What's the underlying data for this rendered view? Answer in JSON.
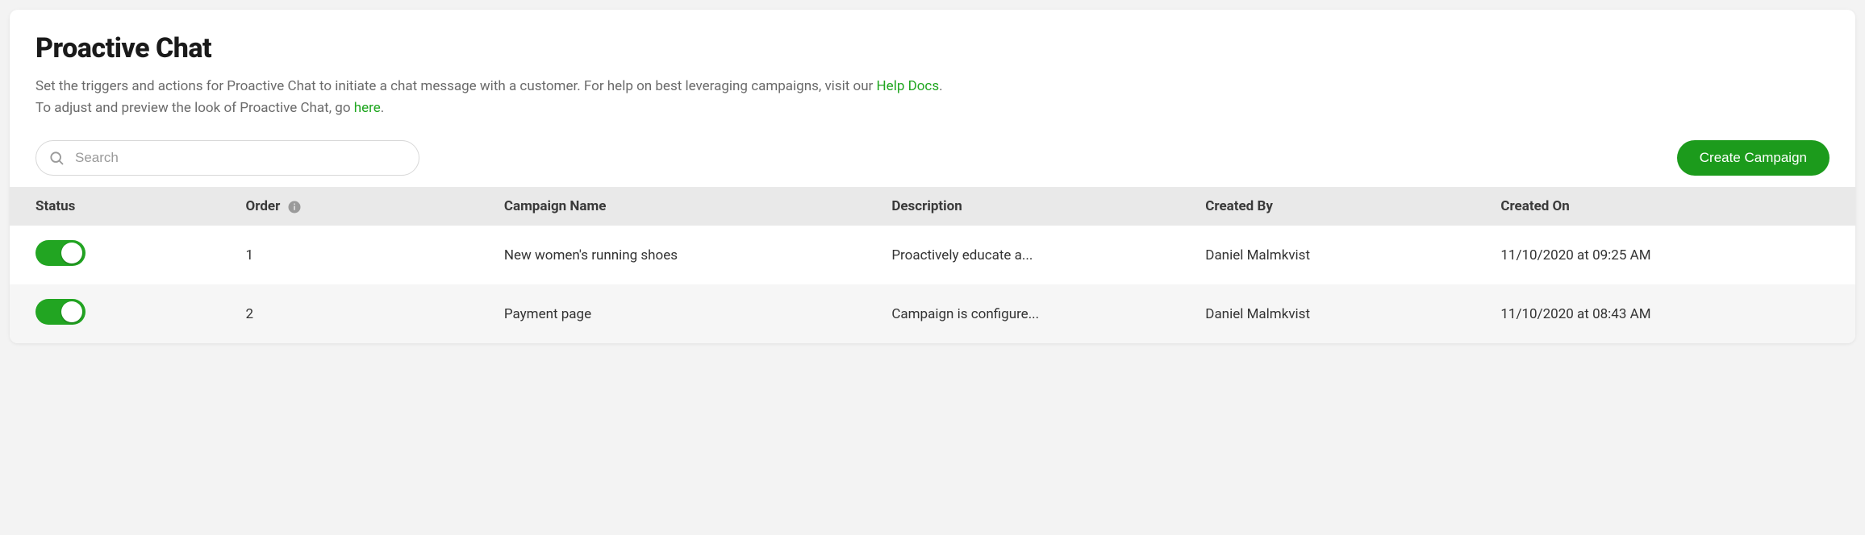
{
  "header": {
    "title": "Proactive Chat",
    "desc_line1_prefix": "Set the triggers and actions for Proactive Chat to initiate a chat message with a customer. For help on best leveraging campaigns, visit our ",
    "desc_line1_link": "Help Docs",
    "desc_line1_suffix": ".",
    "desc_line2_prefix": "To adjust and preview the look of Proactive Chat, go ",
    "desc_line2_link": "here",
    "desc_line2_suffix": "."
  },
  "toolbar": {
    "search_placeholder": "Search",
    "create_label": "Create Campaign"
  },
  "table": {
    "columns": {
      "status": "Status",
      "order": "Order",
      "name": "Campaign Name",
      "description": "Description",
      "created_by": "Created By",
      "created_on": "Created On"
    },
    "rows": [
      {
        "status_on": true,
        "order": "1",
        "name": "New women's running shoes",
        "description": "Proactively educate a...",
        "created_by": "Daniel Malmkvist",
        "created_on": "11/10/2020 at 09:25 AM"
      },
      {
        "status_on": true,
        "order": "2",
        "name": "Payment page",
        "description": "Campaign is configure...",
        "created_by": "Daniel Malmkvist",
        "created_on": "11/10/2020 at 08:43 AM"
      }
    ]
  },
  "colors": {
    "accent_green": "#1c9b1c",
    "link_green": "#1fa61f",
    "toggle_green": "#22a522"
  }
}
